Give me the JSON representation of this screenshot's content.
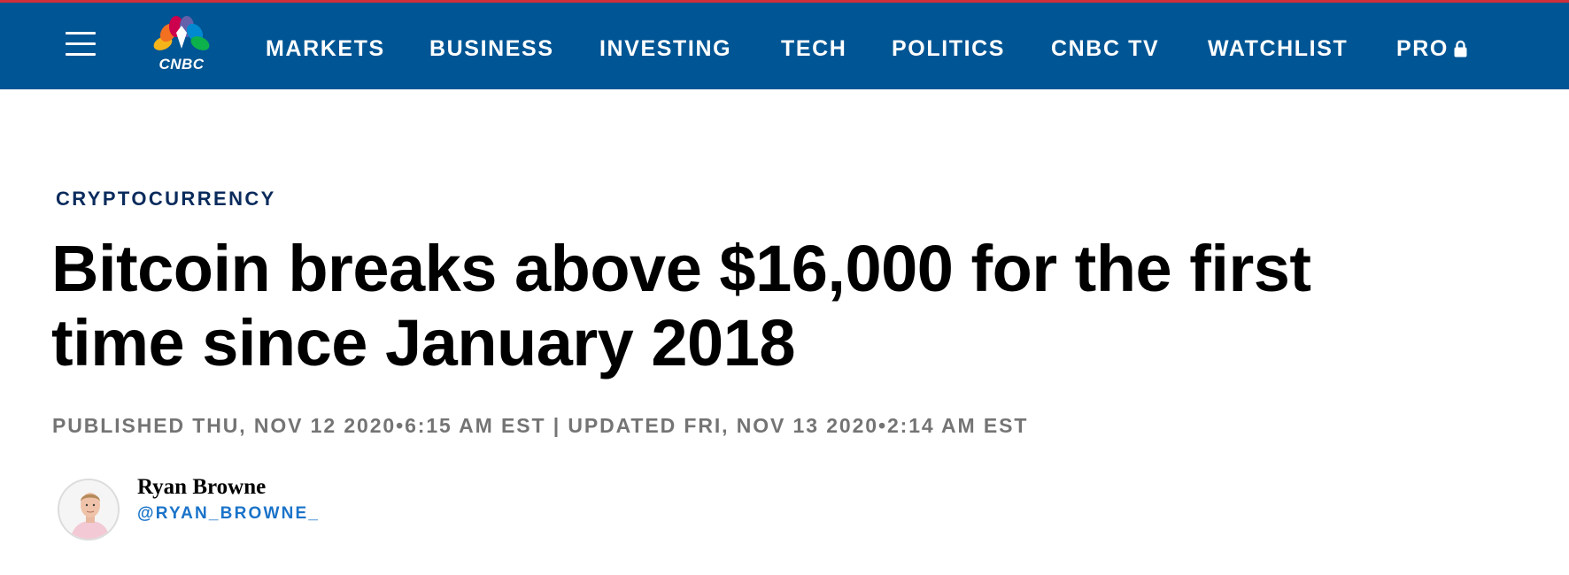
{
  "header": {
    "logo_text": "CNBC",
    "nav": [
      "MARKETS",
      "BUSINESS",
      "INVESTING",
      "TECH",
      "POLITICS",
      "CNBC TV",
      "WATCHLIST",
      "PRO"
    ],
    "pro_icon": "lock-icon",
    "menu_icon": "hamburger-menu-icon",
    "background_color": "#005594",
    "accent_color": "#d0303a"
  },
  "article": {
    "section": "CRYPTOCURRENCY",
    "headline_line1": "Bitcoin breaks above $16,000 for the first",
    "headline_line2": "time since January 2018",
    "timestamps": "PUBLISHED THU, NOV 12 2020•6:15 AM EST | UPDATED FRI, NOV 13 2020•2:14 AM EST",
    "author": {
      "name": "Ryan Browne",
      "handle": "@RYAN_BROWNE_"
    }
  }
}
